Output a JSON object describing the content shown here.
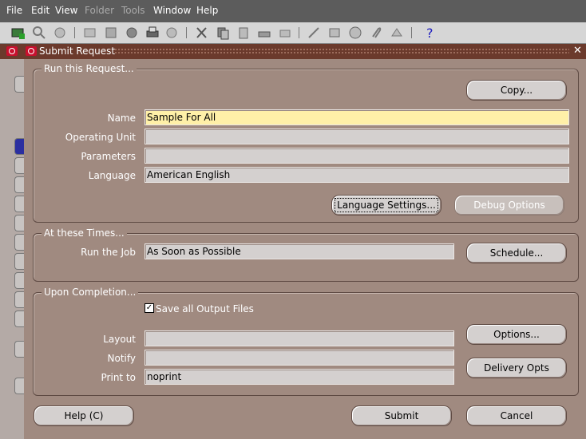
{
  "menu": {
    "file": "File",
    "edit": "Edit",
    "view": "View",
    "folder": "Folder",
    "tools": "Tools",
    "window": "Window",
    "help": "Help"
  },
  "window": {
    "title": "Submit Request",
    "close": "✕"
  },
  "run_group": {
    "title": "Run this Request...",
    "copy_button": "Copy...",
    "name_label": "Name",
    "name_value": "Sample For All",
    "operating_unit_label": "Operating Unit",
    "operating_unit_value": "",
    "parameters_label": "Parameters",
    "parameters_value": "",
    "language_label": "Language",
    "language_value": "American English",
    "language_settings_button": "Language Settings...",
    "debug_options_button": "Debug Options"
  },
  "times_group": {
    "title": "At these Times...",
    "run_job_label": "Run the Job",
    "run_job_value": "As Soon as Possible",
    "schedule_button": "Schedule..."
  },
  "completion_group": {
    "title": "Upon Completion...",
    "save_output_label": "Save all Output Files",
    "save_output_checked": true,
    "layout_label": "Layout",
    "layout_value": "",
    "notify_label": "Notify",
    "notify_value": "",
    "print_to_label": "Print to",
    "print_to_value": "noprint",
    "options_button": "Options...",
    "delivery_opts_button": "Delivery Opts"
  },
  "footer": {
    "help_button": "Help (C)",
    "submit_button": "Submit",
    "cancel_button": "Cancel"
  },
  "colors": {
    "dialog_bg": "#a08a80",
    "title_bar": "#6b3a2c",
    "active_field": "#fff0a8"
  }
}
